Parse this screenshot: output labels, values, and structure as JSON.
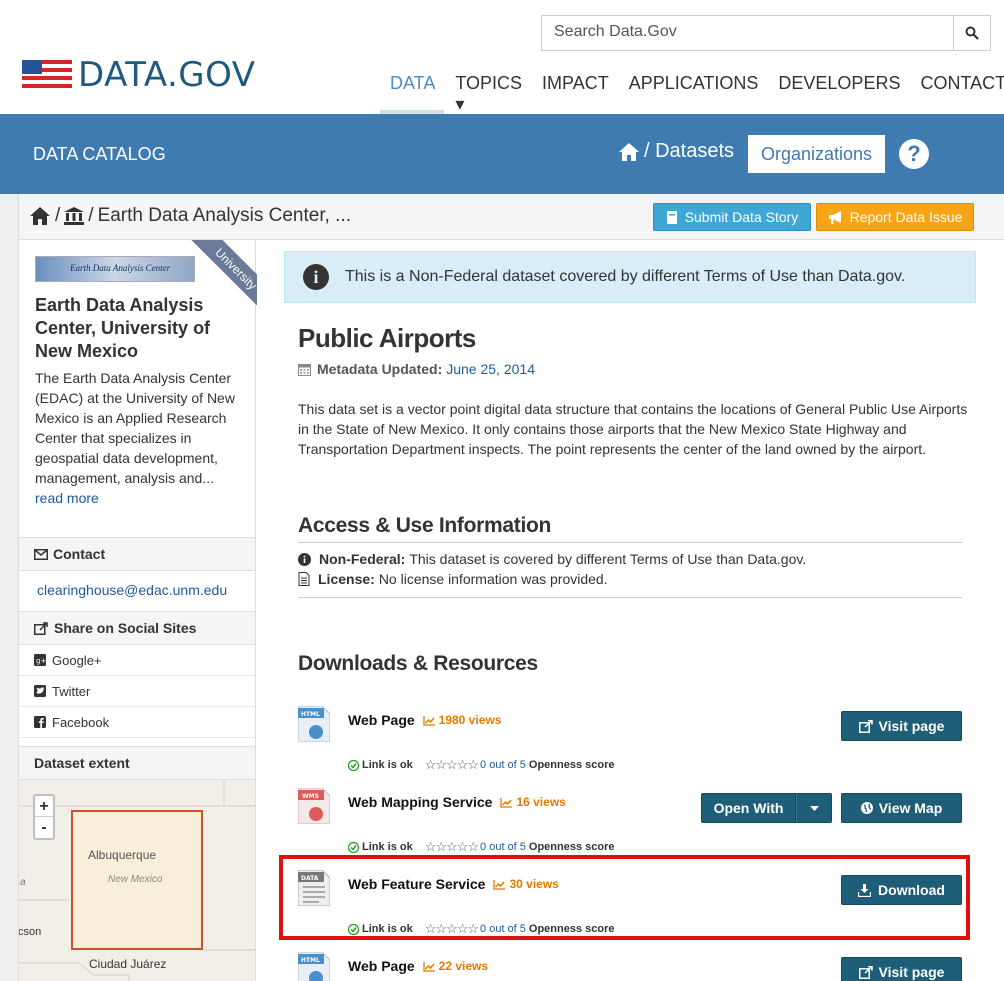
{
  "header": {
    "search_placeholder": "Search Data.Gov",
    "logo_text": "DATA.GOV",
    "nav": [
      "DATA",
      "TOPICS ▾",
      "IMPACT",
      "APPLICATIONS",
      "DEVELOPERS",
      "CONTACT"
    ]
  },
  "band": {
    "title": "DATA CATALOG",
    "crumb": "/ Datasets",
    "organizations": "Organizations",
    "help": "?"
  },
  "breadcrumb": {
    "sep1": "/",
    "sep2": "/",
    "org": "Earth Data Analysis Center, ...",
    "submit_story": "Submit Data Story",
    "report_issue": "Report Data Issue"
  },
  "sidebar": {
    "org_image_text": "Earth Data Analysis Center",
    "ribbon": "University",
    "org_name": "Earth Data Analysis Center, University of New Mexico",
    "org_desc": "The Earth Data Analysis Center (EDAC) at the University of New Mexico is an Applied Research Center that specializes in geospatial data development, management, analysis and...",
    "read_more": "read more",
    "contact_head": "Contact",
    "contact_email": "clearinghouse@edac.unm.edu",
    "share_head": "Share on Social Sites",
    "share_items": [
      "Google+",
      "Twitter",
      "Facebook"
    ],
    "extent_head": "Dataset extent",
    "map_labels": [
      "Albuquerque",
      "New Mexico",
      "Ciudad Juárez",
      "cson",
      "a"
    ],
    "zoom_in": "+",
    "zoom_out": "-"
  },
  "main": {
    "notice": "This is a Non-Federal dataset covered by different Terms of Use than Data.gov.",
    "title": "Public Airports",
    "meta_label": "Metadata Updated:",
    "meta_date": "June 25, 2014",
    "description": "This data set is a vector point digital data structure that contains the locations of General Public Use Airports in the State of New Mexico. It only contains those airports that the New Mexico State Highway and Transportation Department inspects. The point represents the center of the land owned by the airport.",
    "access_heading": "Access & Use Information",
    "nonfed_label": "Non-Federal:",
    "nonfed_text": "This dataset is covered by different Terms of Use than Data.gov.",
    "license_label": "License:",
    "license_text": "No license information was provided.",
    "downloads_heading": "Downloads & Resources",
    "resources": [
      {
        "icon": "HTML",
        "title": "Web Page",
        "views": "1980 views",
        "status": "Link is ok",
        "score": "0 out of 5",
        "score_label": "Openness score",
        "button": "Visit page"
      },
      {
        "icon": "WMS",
        "title": "Web Mapping Service",
        "views": "16 views",
        "status": "Link is ok",
        "score": "0 out of 5",
        "score_label": "Openness score",
        "open_with": "Open With",
        "button": "View Map"
      },
      {
        "icon": "DATA",
        "title": "Web Feature Service",
        "views": "30 views",
        "status": "Link is ok",
        "score": "0 out of 5",
        "score_label": "Openness score",
        "button": "Download"
      },
      {
        "icon": "HTML",
        "title": "Web Page",
        "views": "22 views",
        "button": "Visit page"
      }
    ]
  }
}
